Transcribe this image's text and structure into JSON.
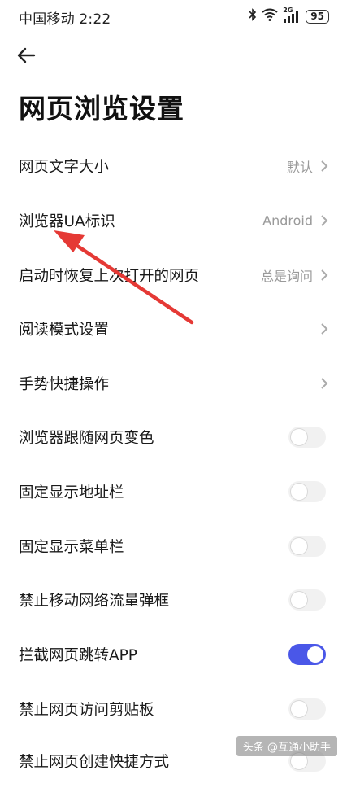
{
  "status_bar": {
    "carrier_time": "中国移动 2:22",
    "battery": "95",
    "network": "2G"
  },
  "page": {
    "title": "网页浏览设置"
  },
  "settings": [
    {
      "label": "网页文字大小",
      "value": "默认",
      "control": "chevron"
    },
    {
      "label": "浏览器UA标识",
      "value": "Android",
      "control": "chevron"
    },
    {
      "label": "启动时恢复上次打开的网页",
      "value": "总是询问",
      "control": "chevron"
    },
    {
      "label": "阅读模式设置",
      "value": "",
      "control": "chevron"
    },
    {
      "label": "手势快捷操作",
      "value": "",
      "control": "chevron"
    },
    {
      "label": "浏览器跟随网页变色",
      "control": "toggle",
      "enabled": false
    },
    {
      "label": "固定显示地址栏",
      "control": "toggle",
      "enabled": false
    },
    {
      "label": "固定显示菜单栏",
      "control": "toggle",
      "enabled": false
    },
    {
      "label": "禁止移动网络流量弹框",
      "control": "toggle",
      "enabled": false
    },
    {
      "label": "拦截网页跳转APP",
      "control": "toggle",
      "enabled": true
    },
    {
      "label": "禁止网页访问剪贴板",
      "control": "toggle",
      "enabled": false
    },
    {
      "label": "禁止网页创建快捷方式",
      "control": "toggle",
      "enabled": false
    }
  ],
  "colors": {
    "toggle_on": "#4a57e8",
    "toggle_off": "#f1f1f1",
    "annotation_arrow": "#e53935"
  },
  "watermark": "头条 @互通小助手"
}
